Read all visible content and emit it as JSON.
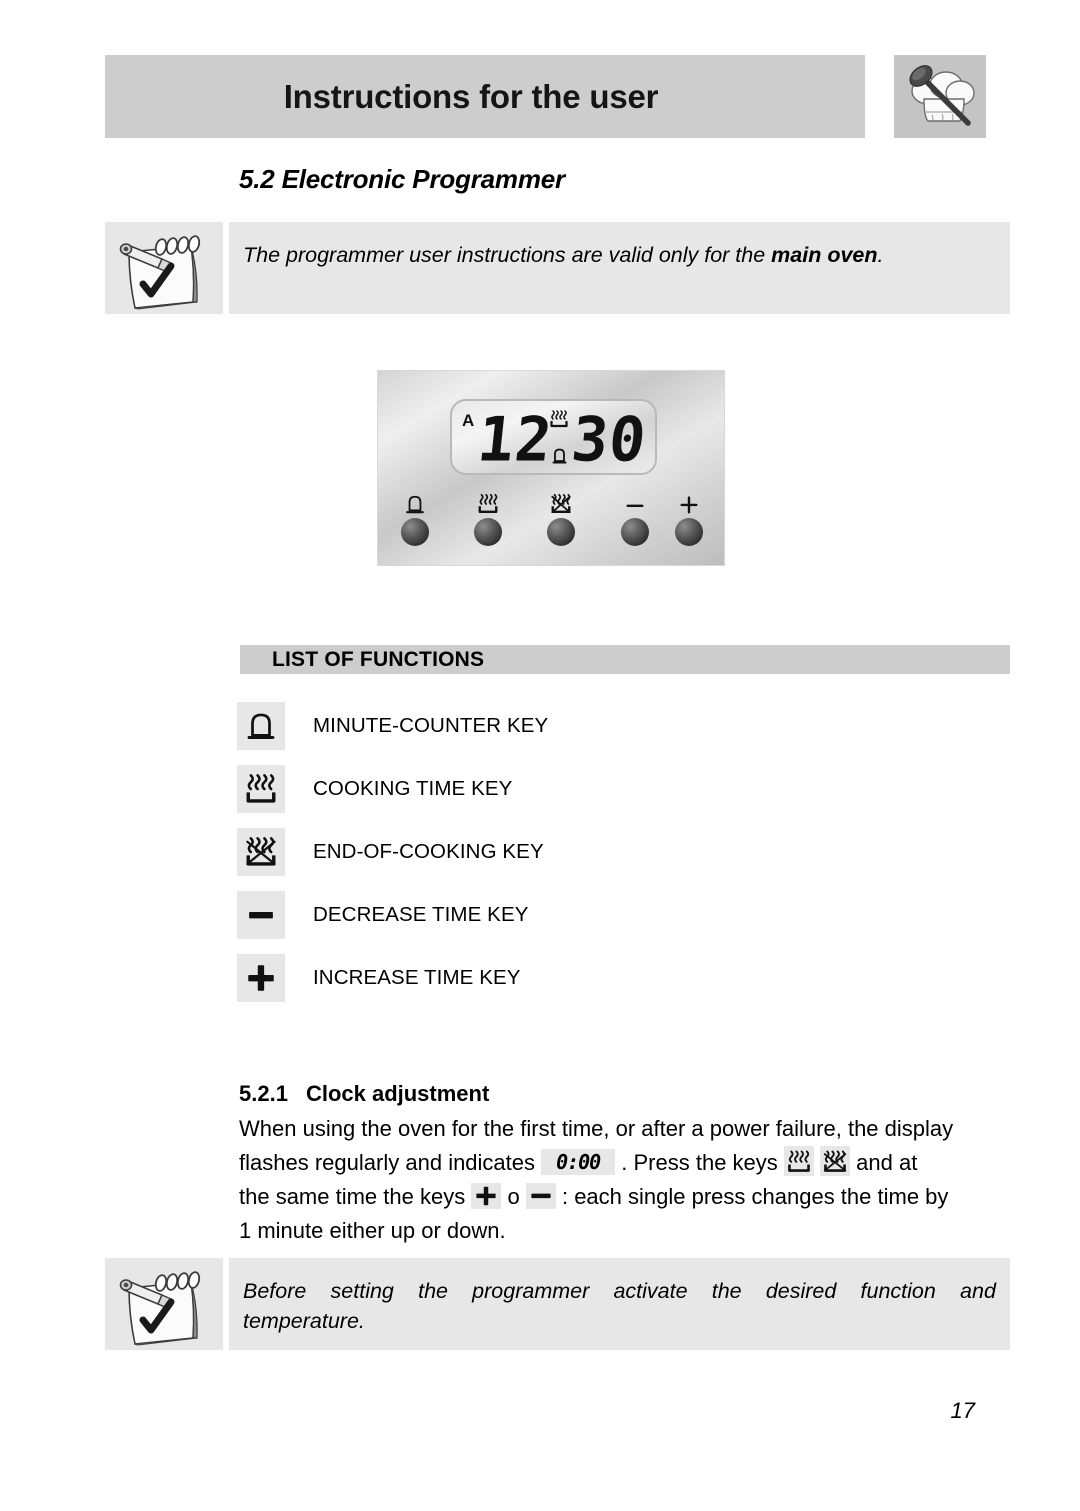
{
  "header": {
    "title": "Instructions for the user",
    "icon": "chef-hat-spoon-icon"
  },
  "section": {
    "number_and_title": "5.2 Electronic Programmer"
  },
  "note_top": {
    "icon": "notepad-pencil-check-icon",
    "text_before_bold": "The programmer user instructions are valid only for the ",
    "bold_text": "main oven",
    "text_after_bold": "."
  },
  "programmer_panel": {
    "display": {
      "auto_indicator": "A",
      "hours": "12",
      "minutes": "30",
      "cooking_indicator_icon": "cooking-icon",
      "bell_indicator_icon": "bell-icon"
    },
    "keys": [
      {
        "name": "minute-counter-key",
        "glyph": "bell-icon"
      },
      {
        "name": "cooking-time-key",
        "glyph": "cooking-icon"
      },
      {
        "name": "end-of-cooking-key",
        "glyph": "end-of-cooking-icon"
      },
      {
        "name": "decrease-time-key",
        "glyph": "minus-icon"
      },
      {
        "name": "increase-time-key",
        "glyph": "plus-icon"
      }
    ]
  },
  "functions": {
    "bar_label": "LIST OF FUNCTIONS",
    "items": [
      {
        "icon": "bell-icon",
        "label": "MINUTE-COUNTER KEY"
      },
      {
        "icon": "cooking-icon",
        "label": "COOKING TIME KEY"
      },
      {
        "icon": "end-of-cooking-icon",
        "label": "END-OF-COOKING KEY"
      },
      {
        "icon": "minus-icon",
        "label": "DECREASE TIME KEY"
      },
      {
        "icon": "plus-icon",
        "label": "INCREASE TIME KEY"
      }
    ]
  },
  "subsection": {
    "number": "5.2.1",
    "title": "Clock adjustment",
    "line1": "When using the oven for the first time, or after a power failure, the display",
    "line2_part1": "flashes",
    "line2_part2": "regularly",
    "line2_part3": "and",
    "line2_part4": "indicates",
    "line2_chip": "0:00",
    "line2_part5": ". Press the keys",
    "line2_part6": "and at",
    "line3_part1": "the same time the keys",
    "line3_part2": "o",
    "line3_part3": ": each single press changes the time by",
    "line4": "1 minute either up or down."
  },
  "note_bottom": {
    "icon": "notepad-pencil-check-icon",
    "line1_words": [
      "Before",
      "setting",
      "the",
      "programmer",
      "activate",
      "the",
      "desired",
      "function",
      "and"
    ],
    "line2": "temperature."
  },
  "page": {
    "number": "17"
  },
  "colors": {
    "header_bar": "#cdcdcd",
    "note_bg": "#e7e7e7",
    "functions_bar": "#cdcdcd",
    "text": "#000000"
  }
}
